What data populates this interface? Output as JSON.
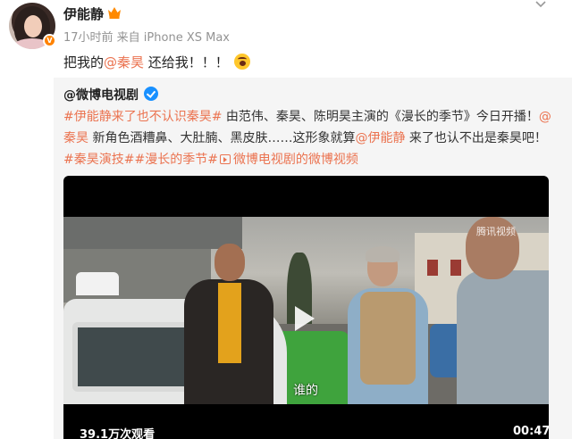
{
  "post": {
    "username": "伊能静",
    "meta": "17小时前  来自 iPhone XS Max",
    "text_prefix": "把我的",
    "text_mention": "@秦昊",
    "text_suffix": " 还给我！！！",
    "verified_badge": "V"
  },
  "repost": {
    "author": "@微博电视剧",
    "line1": {
      "tag": "#伊能静来了也不认识秦昊#",
      "text": " 由范伟、秦昊、陈明昊主演的《漫长的季节》今日开播！",
      "mention": "@"
    },
    "line2": {
      "mention": "秦昊",
      "text": " 新角色酒糟鼻、大肚腩、黑皮肤……这形象就算",
      "mention2": "@伊能静",
      "text2": " 来了也认不出是秦昊吧！"
    },
    "line3": {
      "tag1": "#秦昊演技#",
      "tag2": "#漫长的季节#",
      "video_link": "微博电视剧的微博视频"
    }
  },
  "video": {
    "watermark": "腾讯视频",
    "subtitle": "谁的",
    "views": "39.1万次观看",
    "duration": "00:47"
  },
  "icons": {
    "crown": "crown-icon",
    "emoji": "scream-emoji-icon",
    "verified": "blue-v-icon",
    "play": "play-icon",
    "menu": "chevron-down-icon"
  },
  "colors": {
    "link": "#eb7350",
    "verified_blue": "#1890ff",
    "badge_orange": "#ff8200"
  }
}
